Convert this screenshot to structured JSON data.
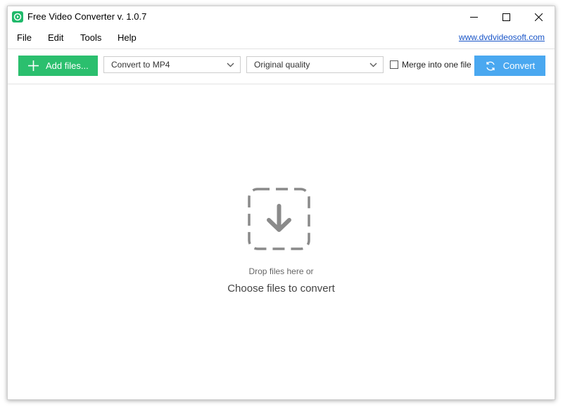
{
  "window": {
    "title": "Free Video Converter v. 1.0.7",
    "brand_color": "#1fb96a"
  },
  "menu": {
    "items": [
      "File",
      "Edit",
      "Tools",
      "Help"
    ],
    "site_link": "www.dvdvideosoft.com"
  },
  "toolbar": {
    "add_files_label": "Add files...",
    "format_selected": "Convert to MP4",
    "quality_selected": "Original quality",
    "merge_label": "Merge into one file",
    "merge_checked": false,
    "convert_label": "Convert",
    "add_button_color": "#2bbf6e",
    "convert_button_color": "#4aa8f0"
  },
  "dropzone": {
    "hint": "Drop files here or",
    "choose_label": "Choose files to convert",
    "icon": "download-dropzone-icon"
  }
}
